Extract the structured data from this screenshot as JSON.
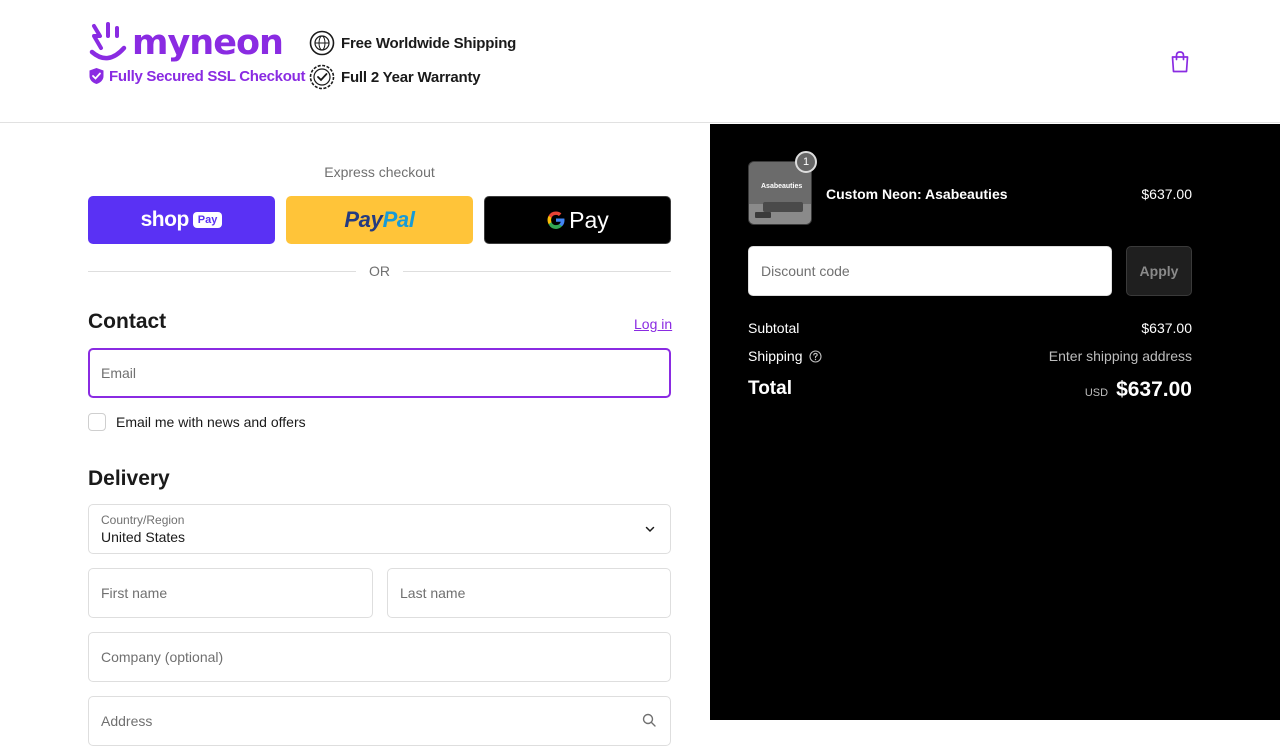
{
  "header": {
    "brand": "myneon",
    "ssl_text": "Fully Secured SSL Checkout",
    "badges": [
      "Free Worldwide Shipping",
      "Full 2 Year Warranty"
    ],
    "cart_icon": "shopping-bag-icon"
  },
  "express": {
    "label": "Express checkout",
    "shop_pay": {
      "word": "shop",
      "pay": "Pay"
    },
    "paypal": {
      "p1": "Pay",
      "p2": "Pal"
    },
    "gpay": {
      "word": "Pay"
    },
    "or_text": "OR"
  },
  "contact": {
    "title": "Contact",
    "login_link": "Log in",
    "email_placeholder": "Email",
    "newsletter_label": "Email me with news and offers"
  },
  "delivery": {
    "title": "Delivery",
    "country_label": "Country/Region",
    "country_value": "United States",
    "first_name_placeholder": "First name",
    "last_name_placeholder": "Last name",
    "company_placeholder": "Company (optional)",
    "address_placeholder": "Address"
  },
  "summary": {
    "item": {
      "quantity": "1",
      "name": "Custom Neon: Asabeauties",
      "thumb_text": "Asabeauties",
      "price": "$637.00"
    },
    "discount_placeholder": "Discount code",
    "apply_label": "Apply",
    "subtotal_label": "Subtotal",
    "subtotal_value": "$637.00",
    "shipping_label": "Shipping",
    "shipping_value": "Enter shipping address",
    "total_label": "Total",
    "currency": "USD",
    "total_value": "$637.00"
  },
  "colors": {
    "brand": "#8a2be2",
    "shop_pay": "#5a31f4",
    "paypal": "#ffc439",
    "summary_bg": "#000000"
  }
}
